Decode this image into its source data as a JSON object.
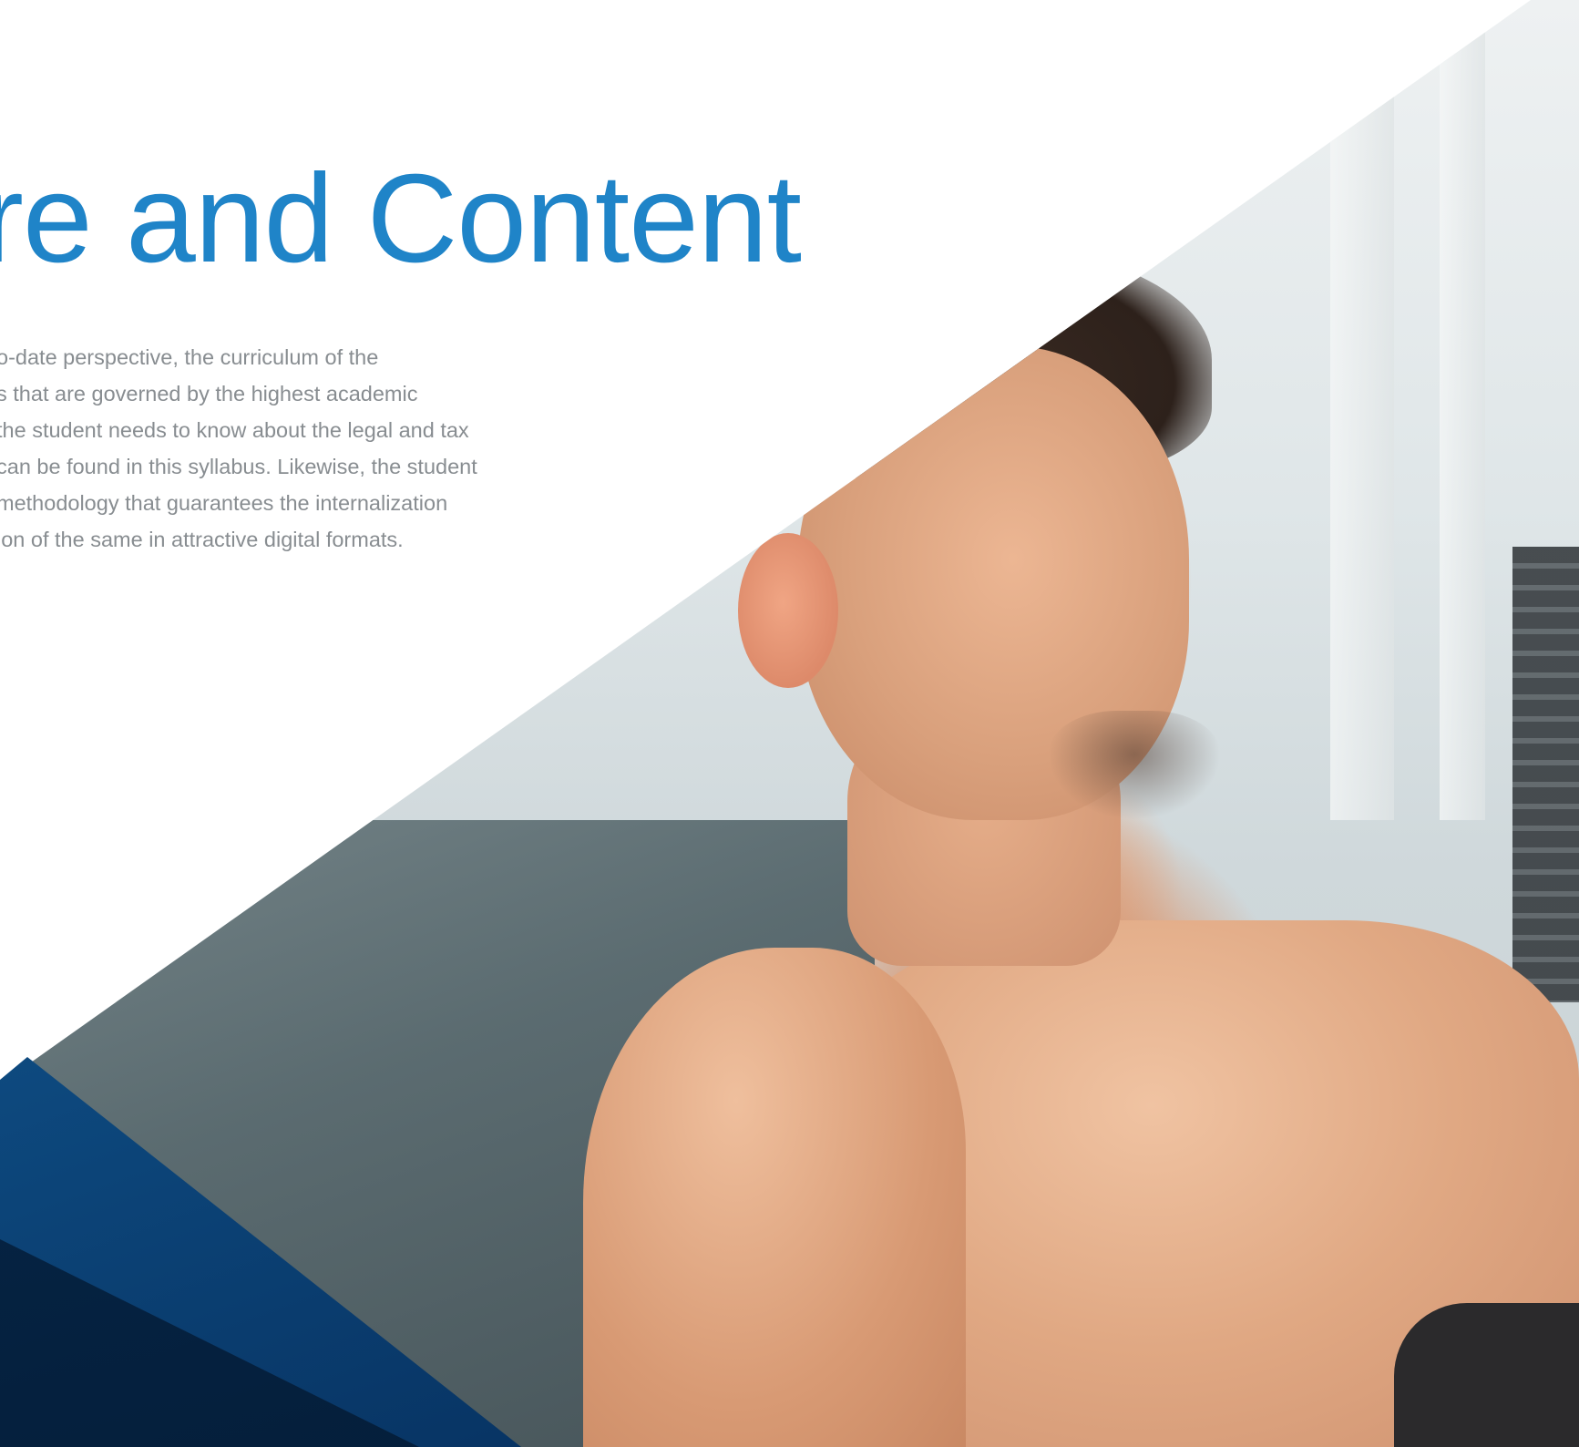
{
  "heading": {
    "title": "re and Content"
  },
  "description": {
    "lines": [
      "o-date perspective, the curriculum of the",
      "s that are governed by the highest academic",
      " the student needs to know about the legal and tax",
      "can be found in this syllabus. Likewise, the student",
      " methodology that guarantees the internalization",
      "ion of the same in attractive digital formats."
    ]
  },
  "colors": {
    "title": "#1f84c8",
    "body_text": "#888d91",
    "accent_blue": "#0f4f86",
    "background": "#ffffff"
  },
  "image": {
    "subject": "man-in-gym-photo"
  }
}
